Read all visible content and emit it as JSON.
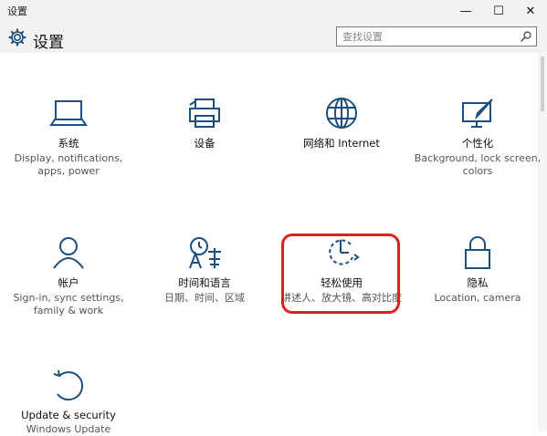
{
  "window": {
    "title": "设置",
    "minimize": "—",
    "maximize": "☐",
    "close": "✕"
  },
  "header": {
    "title": "设置",
    "search_placeholder": "查找设置"
  },
  "tiles": [
    {
      "name": "系统",
      "desc": "Display, notifications, apps, power",
      "icon": "laptop-icon"
    },
    {
      "name": "设备",
      "desc": "",
      "icon": "printer-icon"
    },
    {
      "name": "网络和 Internet",
      "desc": "",
      "icon": "globe-icon"
    },
    {
      "name": "个性化",
      "desc": "Background, lock screen, colors",
      "icon": "paint-icon"
    },
    {
      "name": "帐户",
      "desc": "Sign-in, sync settings, family & work",
      "icon": "person-icon"
    },
    {
      "name": "时间和语言",
      "desc": "日期、时间、区域",
      "icon": "language-icon"
    },
    {
      "name": "轻松使用",
      "desc": "讲述人、放大镜、高对比度",
      "icon": "ease-of-access-icon"
    },
    {
      "name": "隐私",
      "desc": "Location, camera",
      "icon": "lock-icon"
    },
    {
      "name": "Update & security",
      "desc": "Windows Update",
      "icon": "refresh-icon"
    }
  ],
  "colors": {
    "accent": "#1e4f7e",
    "highlight": "#e02020"
  }
}
